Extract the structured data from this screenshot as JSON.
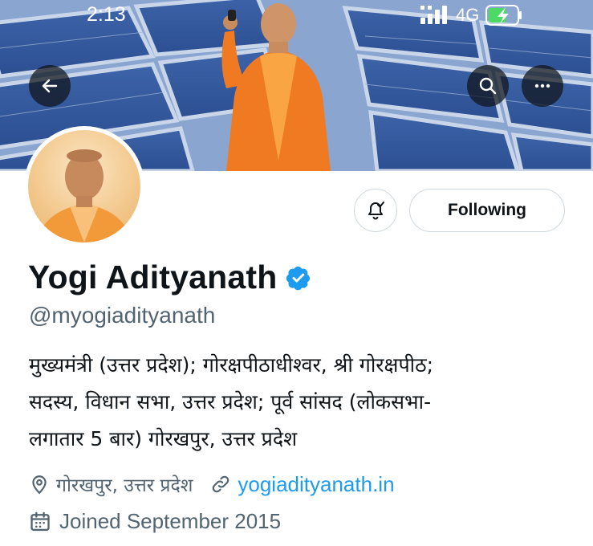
{
  "status_bar": {
    "time": "2:13",
    "network": "4G",
    "icons": [
      "signal-icon",
      "battery-charging-icon"
    ],
    "battery_color": "#4cd964"
  },
  "header": {
    "back_icon": "arrow-left-icon",
    "search_icon": "search-icon",
    "more_icon": "more-horizontal-icon"
  },
  "actions": {
    "notify_icon": "bell-check-icon",
    "following_label": "Following"
  },
  "profile": {
    "display_name": "Yogi Adityanath",
    "verified_badge_color": "#1d9bf0",
    "handle": "@myogiadityanath",
    "bio_lines": [
      "मुख्यमंत्री (उत्तर प्रदेश); गोरक्षपीठाधीश्वर, श्री गोरक्षपीठ;",
      "सदस्य, विधान सभा, उत्तर प्रदेश; पूर्व सांसद (लोकसभा-",
      "लगातार 5 बार) गोरखपुर, उत्तर प्रदेश"
    ],
    "location": "गोरखपुर, उत्तर प्रदेश",
    "website": "yogiadityanath.in",
    "joined": "Joined September 2015"
  },
  "colors": {
    "text_primary": "#0f1419",
    "text_secondary": "#536471",
    "link": "#1d9bf0",
    "border": "#cfd9de"
  }
}
